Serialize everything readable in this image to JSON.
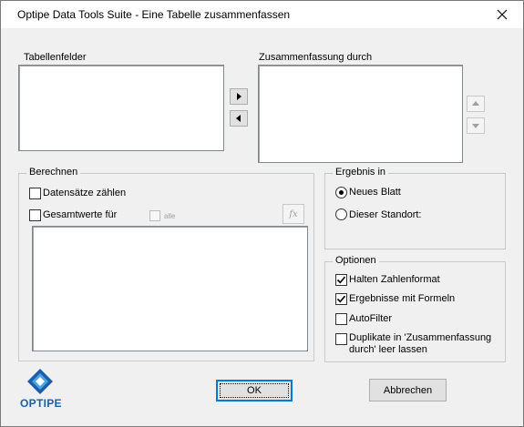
{
  "window": {
    "title": "Optipe Data Tools Suite - Eine Tabelle zusammenfassen",
    "close_icon": "close-icon"
  },
  "fields": {
    "tabellenfelder_label": "Tabellenfelder",
    "zusammenfassung_label": "Zusammenfassung durch",
    "move_right_icon": "triangle-right-icon",
    "move_left_icon": "triangle-left-icon",
    "move_up_icon": "triangle-up-icon",
    "move_down_icon": "triangle-down-icon"
  },
  "berechnen": {
    "title": "Berechnen",
    "count_label": "Datensätze zählen",
    "count_checked": false,
    "totals_label": "Gesamtwerte für",
    "totals_checked": false,
    "all_label": "alle",
    "all_checked": false,
    "fx_label": "fx"
  },
  "ergebnis": {
    "title": "Ergebnis in",
    "options": [
      {
        "label": "Neues Blatt",
        "selected": true
      },
      {
        "label": "Dieser Standort:",
        "selected": false
      }
    ]
  },
  "optionen": {
    "title": "Optionen",
    "items": [
      {
        "label": "Halten Zahlenformat",
        "checked": true
      },
      {
        "label": "Ergebnisse mit Formeln",
        "checked": true
      },
      {
        "label": "AutoFilter",
        "checked": false
      },
      {
        "label_line1": "Duplikate in 'Zusammenfassung",
        "label_line2": "durch' leer lassen",
        "checked": false
      }
    ]
  },
  "footer": {
    "logo_text": "OPTIPE",
    "ok_label": "OK",
    "cancel_label": "Abbrechen"
  },
  "colors": {
    "accent": "#0078d7",
    "logo_blue": "#1a5fa8",
    "dialog_bg": "#f0f0f0"
  }
}
